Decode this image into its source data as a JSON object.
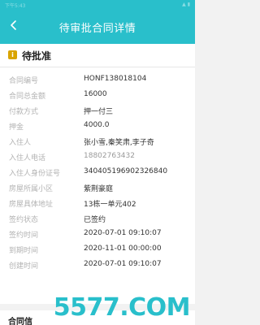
{
  "header": {
    "title": "待审批合同详情",
    "status_time": "下午5:43",
    "status_icons": "▲ ▮"
  },
  "card": {
    "title": "待批准",
    "icon": "info-icon"
  },
  "details": [
    {
      "label": "合同编号",
      "value": "HONF138018104"
    },
    {
      "label": "合同总金额",
      "value": "16000"
    },
    {
      "label": "付款方式",
      "value": "押一付三"
    },
    {
      "label": "押金",
      "value": "4000.0"
    },
    {
      "label": "入住人",
      "value": "张小雪,秦笑肃,李子奇"
    },
    {
      "label": "入住人电话",
      "value": "18802763432"
    },
    {
      "label": "入住人身份证号",
      "value": "340405196902326840"
    },
    {
      "label": "房屋所属小区",
      "value": "紫荆豪庭"
    },
    {
      "label": "房屋具体地址",
      "value": "13栋一单元402"
    },
    {
      "label": "签约状态",
      "value": "已签约"
    },
    {
      "label": "签约时间",
      "value": "2020-07-01 09:10:07"
    },
    {
      "label": "到期时间",
      "value": "2020-11-01 00:00:00"
    },
    {
      "label": "创建时间",
      "value": "2020-07-01 09:10:07"
    }
  ],
  "section2": {
    "label": "合同信"
  },
  "watermark": "5577.COM",
  "colors": {
    "accent": "#29bfcb",
    "badge": "#d9a400"
  }
}
